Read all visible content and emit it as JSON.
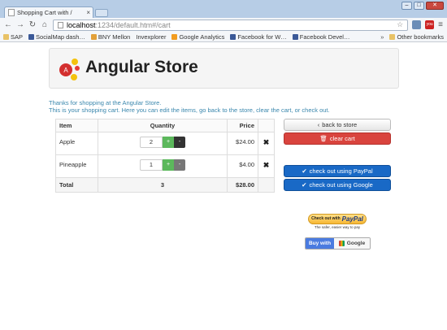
{
  "browser": {
    "tab_title": "Shopping Cart with /",
    "tab_close": "×",
    "url_host": "localhost",
    "url_path": ":1234/default.htm#/cart",
    "ext_b_label": "you",
    "bookmarks": [
      "SAP",
      "SocialMap dash…",
      "BNY Mellon",
      "Invexplorer",
      "Google Analytics",
      "Facebook for W…",
      "Facebook Devel…"
    ],
    "bookmarks_overflow": "»",
    "other_bookmarks": "Other bookmarks"
  },
  "store": {
    "title": "Angular Store",
    "intro_line1": "Thanks for shopping at the Angular Store.",
    "intro_line2": "This is your shopping cart. Here you can edit the items, go back to the store, clear the cart, or check out."
  },
  "cart": {
    "headers": {
      "item": "Item",
      "quantity": "Quantity",
      "price": "Price"
    },
    "items": [
      {
        "name": "Apple",
        "qty": "2",
        "price": "$24.00"
      },
      {
        "name": "Pineapple",
        "qty": "1",
        "price": "$4.00"
      }
    ],
    "plus_label": "+",
    "minus_label": "-",
    "total_label": "Total",
    "total_qty": "3",
    "total_price": "$28.00"
  },
  "actions": {
    "back": "back to store",
    "clear": "clear cart",
    "paypal": "check out using PayPal",
    "google": "check out using Google"
  },
  "badges": {
    "paypal_checkout": "Check out with",
    "paypal_logo": "PayPal",
    "paypal_tagline": "The safer, easier way to pay",
    "google_buy": "Buy with",
    "google_logo": "Google"
  },
  "colors": {
    "accent_link": "#3a87ad",
    "success": "#5cb85c",
    "danger": "#d9443e",
    "primary": "#1969c6"
  }
}
